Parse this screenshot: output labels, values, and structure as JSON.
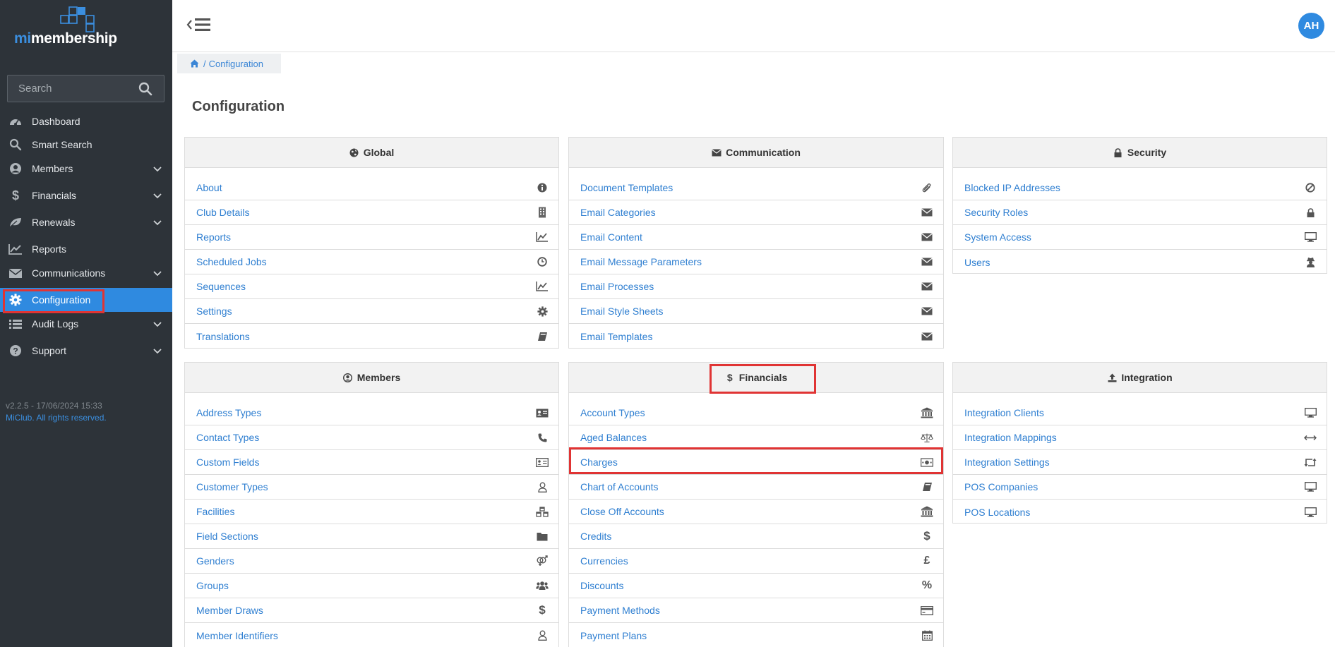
{
  "app": {
    "logo_mi": "mi",
    "logo_rest": "membership"
  },
  "sidebar": {
    "search_placeholder": "Search",
    "items": [
      {
        "label": "Dashboard",
        "icon": "dashboard-icon"
      },
      {
        "label": "Smart Search",
        "icon": "search-icon"
      },
      {
        "label": "Members",
        "icon": "user-circle-icon"
      },
      {
        "label": "Financials",
        "icon": "dollar-icon"
      },
      {
        "label": "Renewals",
        "icon": "leaf-icon"
      },
      {
        "label": "Reports",
        "icon": "line-chart-icon"
      },
      {
        "label": "Communications",
        "icon": "envelope-icon"
      },
      {
        "label": "Configuration",
        "icon": "gear-icon"
      },
      {
        "label": "Audit Logs",
        "icon": "list-icon"
      },
      {
        "label": "Support",
        "icon": "question-circle-icon"
      }
    ],
    "active": "Configuration",
    "version": "v2.2.5 - 17/06/2024 15:33",
    "copyright": "MiClub. All rights reserved."
  },
  "header": {
    "avatar_initials": "AH"
  },
  "breadcrumb": {
    "separator": "/",
    "current": "Configuration"
  },
  "page": {
    "title": "Configuration"
  },
  "panels": {
    "global": {
      "title": "Global",
      "icon": "globe-icon",
      "items": [
        {
          "label": "About",
          "icon": "info-circle-icon"
        },
        {
          "label": "Club Details",
          "icon": "building-icon"
        },
        {
          "label": "Reports",
          "icon": "line-chart-icon"
        },
        {
          "label": "Scheduled Jobs",
          "icon": "clock-icon"
        },
        {
          "label": "Sequences",
          "icon": "line-chart-icon"
        },
        {
          "label": "Settings",
          "icon": "gear-icon"
        },
        {
          "label": "Translations",
          "icon": "book-icon"
        }
      ]
    },
    "communication": {
      "title": "Communication",
      "icon": "envelope-icon",
      "items": [
        {
          "label": "Document Templates",
          "icon": "paperclip-icon"
        },
        {
          "label": "Email Categories",
          "icon": "envelope-icon"
        },
        {
          "label": "Email Content",
          "icon": "envelope-icon"
        },
        {
          "label": "Email Message Parameters",
          "icon": "envelope-icon"
        },
        {
          "label": "Email Processes",
          "icon": "envelope-icon"
        },
        {
          "label": "Email Style Sheets",
          "icon": "envelope-icon"
        },
        {
          "label": "Email Templates",
          "icon": "envelope-icon"
        }
      ]
    },
    "security": {
      "title": "Security",
      "icon": "lock-icon",
      "items": [
        {
          "label": "Blocked IP Addresses",
          "icon": "ban-icon"
        },
        {
          "label": "Security Roles",
          "icon": "lock-icon"
        },
        {
          "label": "System Access",
          "icon": "desktop-icon"
        },
        {
          "label": "Users",
          "icon": "user-secret-icon"
        }
      ]
    },
    "members": {
      "title": "Members",
      "icon": "user-circle-icon",
      "items": [
        {
          "label": "Address Types",
          "icon": "address-card-icon"
        },
        {
          "label": "Contact Types",
          "icon": "phone-icon"
        },
        {
          "label": "Custom Fields",
          "icon": "id-card-icon"
        },
        {
          "label": "Customer Types",
          "icon": "user-outline-icon"
        },
        {
          "label": "Facilities",
          "icon": "cubes-icon"
        },
        {
          "label": "Field Sections",
          "icon": "folder-icon"
        },
        {
          "label": "Genders",
          "icon": "genderless-icon"
        },
        {
          "label": "Groups",
          "icon": "users-icon"
        },
        {
          "label": "Member Draws",
          "icon": "dollar-icon"
        },
        {
          "label": "Member Identifiers",
          "icon": "user-outline-icon"
        }
      ]
    },
    "financials": {
      "title": "Financials",
      "icon": "dollar-icon",
      "items": [
        {
          "label": "Account Types",
          "icon": "bank-icon"
        },
        {
          "label": "Aged Balances",
          "icon": "balance-scale-icon"
        },
        {
          "label": "Charges",
          "icon": "money-icon"
        },
        {
          "label": "Chart of Accounts",
          "icon": "book-icon"
        },
        {
          "label": "Close Off Accounts",
          "icon": "bank-icon"
        },
        {
          "label": "Credits",
          "icon": "dollar-icon"
        },
        {
          "label": "Currencies",
          "icon": "pound-icon"
        },
        {
          "label": "Discounts",
          "icon": "percent-icon"
        },
        {
          "label": "Payment Methods",
          "icon": "credit-card-icon"
        },
        {
          "label": "Payment Plans",
          "icon": "calendar-icon"
        }
      ]
    },
    "integration": {
      "title": "Integration",
      "icon": "upload-icon",
      "items": [
        {
          "label": "Integration Clients",
          "icon": "desktop-icon"
        },
        {
          "label": "Integration Mappings",
          "icon": "arrows-h-icon"
        },
        {
          "label": "Integration Settings",
          "icon": "retweet-icon"
        },
        {
          "label": "POS Companies",
          "icon": "desktop-icon"
        },
        {
          "label": "POS Locations",
          "icon": "desktop-icon"
        }
      ]
    }
  },
  "colors": {
    "sidebar_bg": "#2d3339",
    "accent": "#2f8ae0",
    "link": "#2f7fd1",
    "highlight": "#e03434"
  }
}
